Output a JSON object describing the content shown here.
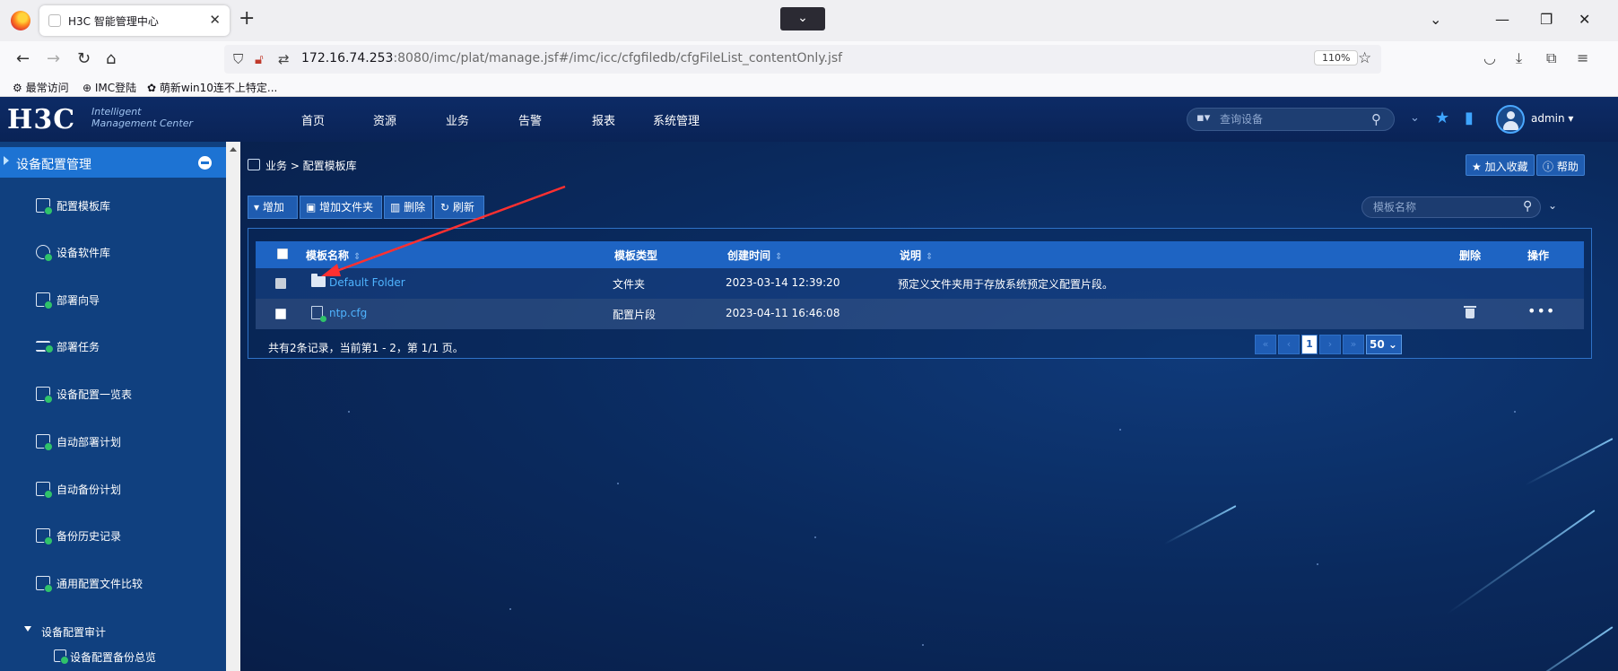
{
  "browser": {
    "tab_title": "H3C 智能管理中心",
    "url_host": "172.16.74.253",
    "url_rest": ":8080/imc/plat/manage.jsf#/imc/icc/cfgfiledb/cfgFileList_contentOnly.jsf",
    "zoom": "110%",
    "bookmarks": [
      "最常访问",
      "IMC登陆",
      "萌新win10连不上特定..."
    ]
  },
  "app": {
    "logo": "H3C",
    "logo_sub_1": "Intelligent",
    "logo_sub_2": "Management Center",
    "nav": [
      "首页",
      "资源",
      "业务",
      "告警",
      "报表",
      "系统管理"
    ],
    "search_placeholder": "查询设备",
    "username": "admin"
  },
  "sidebar": {
    "title": "设备配置管理",
    "items": [
      "配置模板库",
      "设备软件库",
      "部署向导",
      "部署任务",
      "设备配置一览表",
      "自动部署计划",
      "自动备份计划",
      "备份历史记录",
      "通用配置文件比较"
    ],
    "group": "设备配置审计",
    "sub_item": "设备配置备份总览"
  },
  "main": {
    "breadcrumb": "业务 > 配置模板库",
    "favorite_btn": "加入收藏",
    "help_btn": "帮助",
    "toolbar": {
      "add": "增加",
      "add_folder": "增加文件夹",
      "delete": "删除",
      "refresh": "刷新"
    },
    "tpl_search_placeholder": "模板名称",
    "columns": {
      "name": "模板名称",
      "type": "模板类型",
      "created": "创建时间",
      "desc": "说明",
      "delete": "删除",
      "action": "操作"
    },
    "rows": [
      {
        "name": "Default Folder",
        "type": "文件夹",
        "created": "2023-03-14 12:39:20",
        "desc": "预定义文件夹用于存放系统预定义配置片段。"
      },
      {
        "name": "ntp.cfg",
        "type": "配置片段",
        "created": "2023-04-11 16:46:08",
        "desc": ""
      }
    ],
    "footer": "共有2条记录，当前第1 - 2，第 1/1 页。",
    "pager": {
      "current": "1",
      "page_size": "50"
    }
  },
  "colors": {
    "accent": "#1d73d3",
    "link": "#4fb4ff",
    "annotation": "#ff3030"
  }
}
